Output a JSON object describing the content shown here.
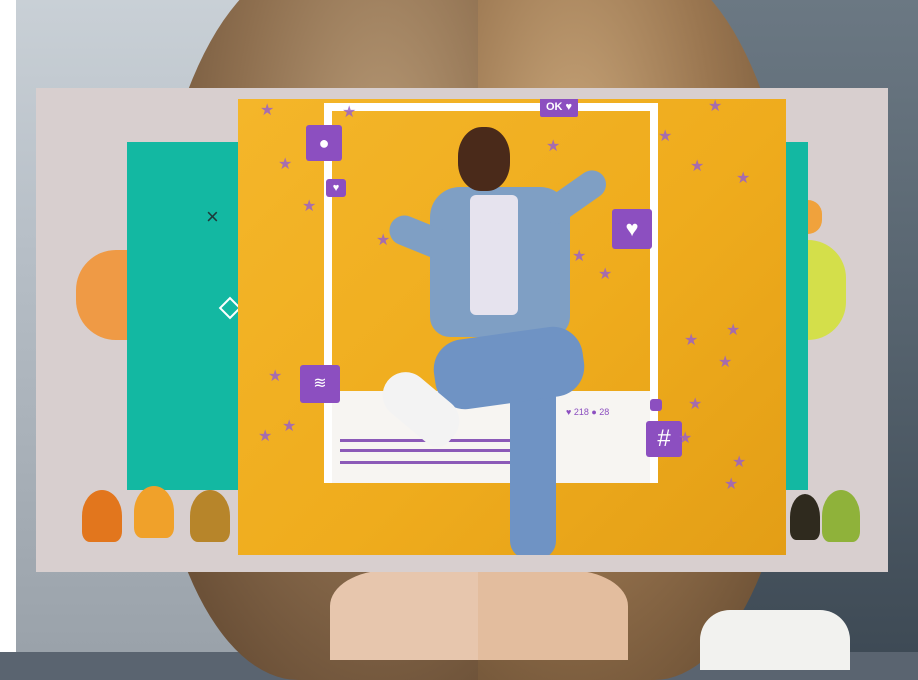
{
  "photo_card": {
    "tag_text": "OK ♥",
    "likes_text": "♥ 218  ● 28",
    "hashtag_icon": "#",
    "comment_icon": "speech-bubble-icon",
    "heart_icon": "heart-icon"
  },
  "illustration": {
    "x_glyph": "×",
    "colors": {
      "teal": "#13b8a2",
      "card": "#d8cfcf",
      "orange": "#ef9a45",
      "lime": "#d4df4a"
    }
  },
  "colors": {
    "yellow_bg": "#f4b62a",
    "accent_purple": "#8c4fc0"
  }
}
